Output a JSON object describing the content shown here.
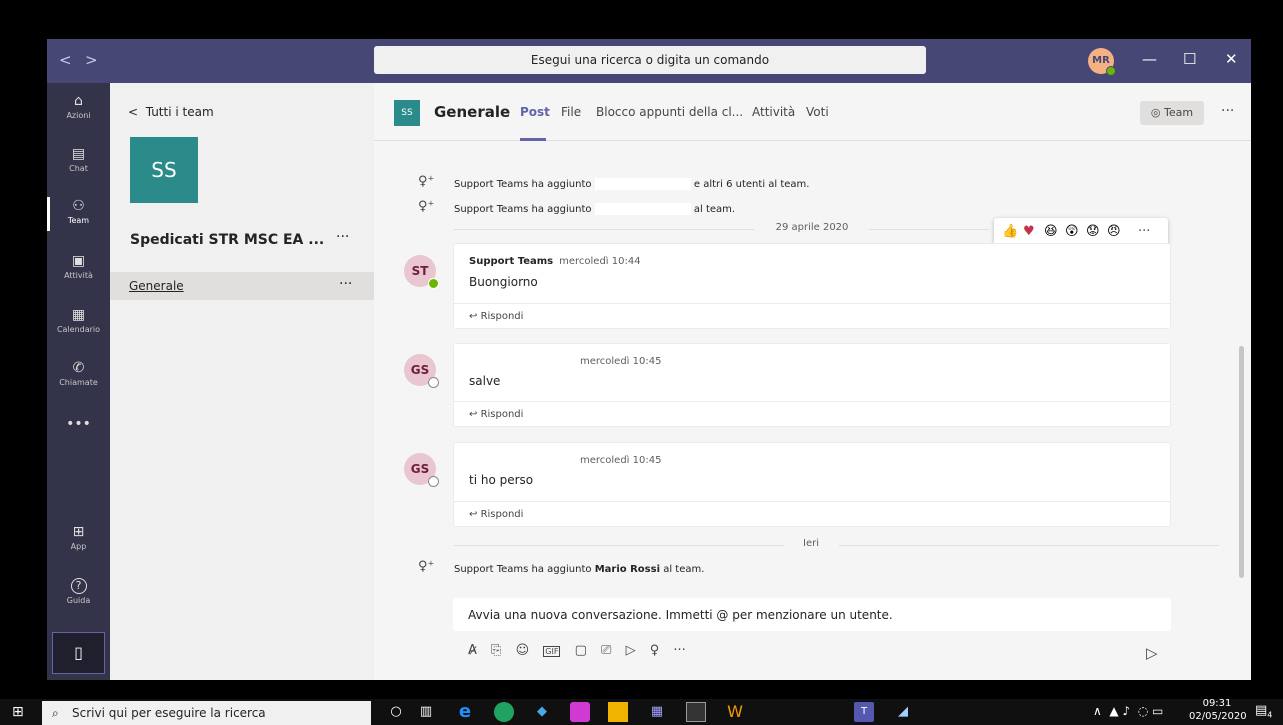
{
  "titlebar": {
    "back": "<",
    "forward": ">",
    "compose_icon": "compose-icon",
    "search_placeholder": "Esegui una ricerca o digita un comando",
    "avatar_initials": "MR",
    "minimize": "—",
    "maximize": "☐",
    "close": "✕"
  },
  "appbar": {
    "items": [
      {
        "label": "Azioni",
        "icon": "bell-icon",
        "glyph": "🔔"
      },
      {
        "label": "Chat",
        "icon": "chat-icon",
        "glyph": "▤"
      },
      {
        "label": "Team",
        "icon": "team-icon",
        "glyph": "⚇"
      },
      {
        "label": "Attività",
        "icon": "backpack-icon",
        "glyph": "▣"
      },
      {
        "label": "Calendario",
        "icon": "calendar-icon",
        "glyph": "▦"
      },
      {
        "label": "Chiamate",
        "icon": "phone-icon",
        "glyph": "✆"
      },
      {
        "label": "",
        "icon": "more-icon",
        "glyph": "•••"
      },
      {
        "label": "App",
        "icon": "apps-icon",
        "glyph": "⊞"
      },
      {
        "label": "Guida",
        "icon": "help-icon",
        "glyph": "?"
      }
    ],
    "active": "Team",
    "device_icon": "mobile-icon"
  },
  "teampane": {
    "back_label": "Tutti i team",
    "team_initials": "SS",
    "team_name": "Spedicati STR MSC EA ...",
    "more": "···",
    "channel": "Generale"
  },
  "header": {
    "channel_initials": "SS",
    "channel_title": "Generale",
    "tabs": [
      "Post",
      "File",
      "Blocco appunti della cl...",
      "Attività",
      "Voti"
    ],
    "active_tab": "Post",
    "team_button": "◎ Team",
    "more": "···"
  },
  "feed": {
    "system1": {
      "prefix": "Support Teams ha aggiunto",
      "suffix": "e altri 6 utenti al team."
    },
    "system2": {
      "prefix": "Support Teams ha aggiunto",
      "suffix": "al team."
    },
    "date1": "29 aprile 2020",
    "messages": [
      {
        "initials": "ST",
        "author": "Support Teams",
        "time": "mercoledì 10:44",
        "text": "Buongiorno",
        "presence": "online",
        "reply": "Rispondi"
      },
      {
        "initials": "GS",
        "author": "",
        "time": "mercoledì 10:45",
        "text": "salve",
        "presence": "offline",
        "reply": "Rispondi"
      },
      {
        "initials": "GS",
        "author": "",
        "time": "mercoledì 10:45",
        "text": "ti ho perso",
        "presence": "offline",
        "reply": "Rispondi"
      }
    ],
    "date2": "Ieri",
    "system3": {
      "prefix": "Support Teams ha aggiunto",
      "name": "Mario Rossi",
      "suffix": "al team."
    }
  },
  "reactions": [
    "👍",
    "❤️",
    "😆",
    "😲",
    "😟",
    "😠",
    "···"
  ],
  "compose": {
    "placeholder": "Avvia una nuova conversazione. Immetti @ per menzionare un utente.",
    "tools": [
      "A̷",
      "⎘",
      "☺",
      "GIF",
      "▢",
      "⎚",
      "▷",
      "♀",
      "···"
    ],
    "send_icon": "send-icon"
  },
  "taskbar": {
    "search_placeholder": "Scrivi qui per eseguire la ricerca",
    "time": "09:31",
    "date": "02/05/2020",
    "notif_count": "4"
  },
  "colors": {
    "accent": "#6264a7",
    "titlebar": "#464775",
    "appbar": "#33344a",
    "team_tile": "#2b8a8a"
  }
}
